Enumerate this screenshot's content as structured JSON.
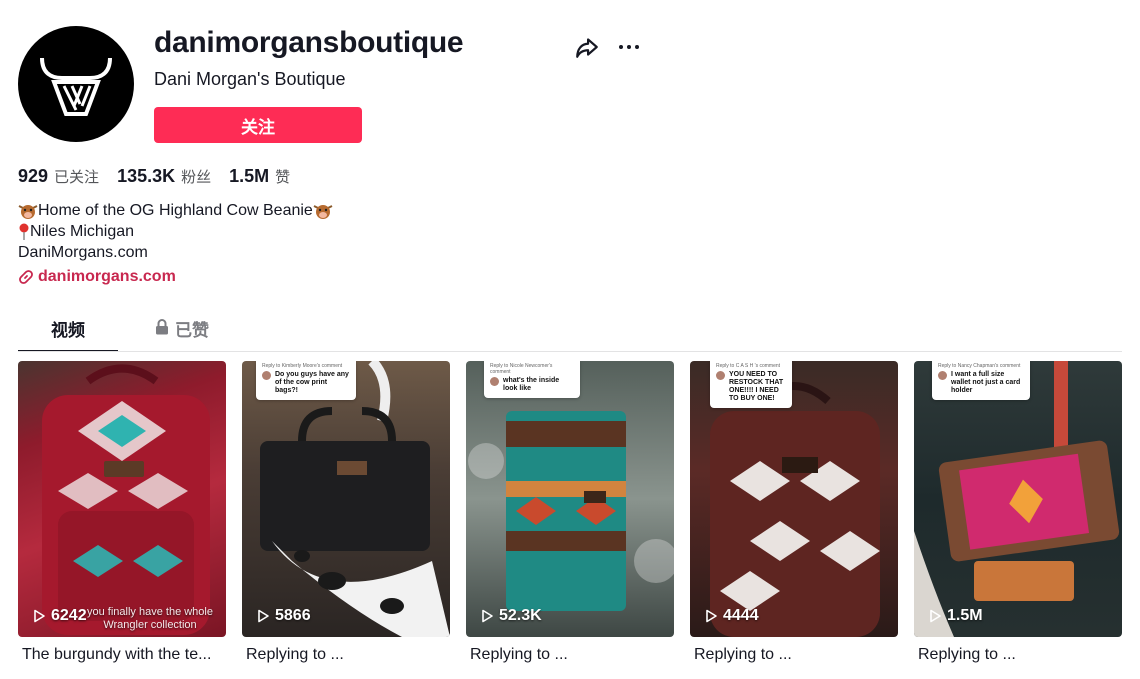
{
  "profile": {
    "username": "danimorgansboutique",
    "nickname": "Dani Morgan's Boutique",
    "follow_label": "关注",
    "avatar_icon": "bull-logo-icon"
  },
  "stats": {
    "following": {
      "value": "929",
      "label": "已关注"
    },
    "followers": {
      "value": "135.3K",
      "label": "粉丝"
    },
    "likes": {
      "value": "1.5M",
      "label": "赞"
    }
  },
  "bio": {
    "line1": "Home of the OG Highland Cow Beanie",
    "line2": "Niles Michigan",
    "line3": "DaniMorgans.com"
  },
  "link": {
    "text": "danimorgans.com"
  },
  "tabs": [
    {
      "label": "视频",
      "active": true
    },
    {
      "label": "已赞",
      "locked": true
    }
  ],
  "videos": [
    {
      "views": "6242",
      "caption": "The burgundy with the te...",
      "overlay_text": "you finally have the whole Wrangler collection",
      "colors": [
        "#8e1b2c",
        "#b52a3e"
      ]
    },
    {
      "views": "5866",
      "caption": "Replying to ...",
      "reply_to": "Reply to Kimberly Moore's comment",
      "question": "Do you guys have any of the cow print bags?!",
      "colors": [
        "#5a4a3f",
        "#2b2523"
      ]
    },
    {
      "views": "52.3K",
      "caption": "Replying to ...",
      "reply_to": "Reply to Nicole Newcomer's comment",
      "question": "what's the inside look like",
      "colors": [
        "#6b7a74",
        "#1f8a84"
      ]
    },
    {
      "views": "4444",
      "caption": "Replying to ...",
      "reply_to": "Reply to C A S H 's comment",
      "question": "YOU NEED TO RESTOCK THAT ONE!!!! I NEED TO BUY ONE!",
      "colors": [
        "#5b2a26",
        "#3a1b1a"
      ]
    },
    {
      "views": "1.5M",
      "caption": "Replying to ...",
      "reply_to": "Reply to Nancy Chapman's comment",
      "question": "I want a full size wallet not just a card holder",
      "colors": [
        "#3c3a37",
        "#d02a6e"
      ]
    }
  ]
}
